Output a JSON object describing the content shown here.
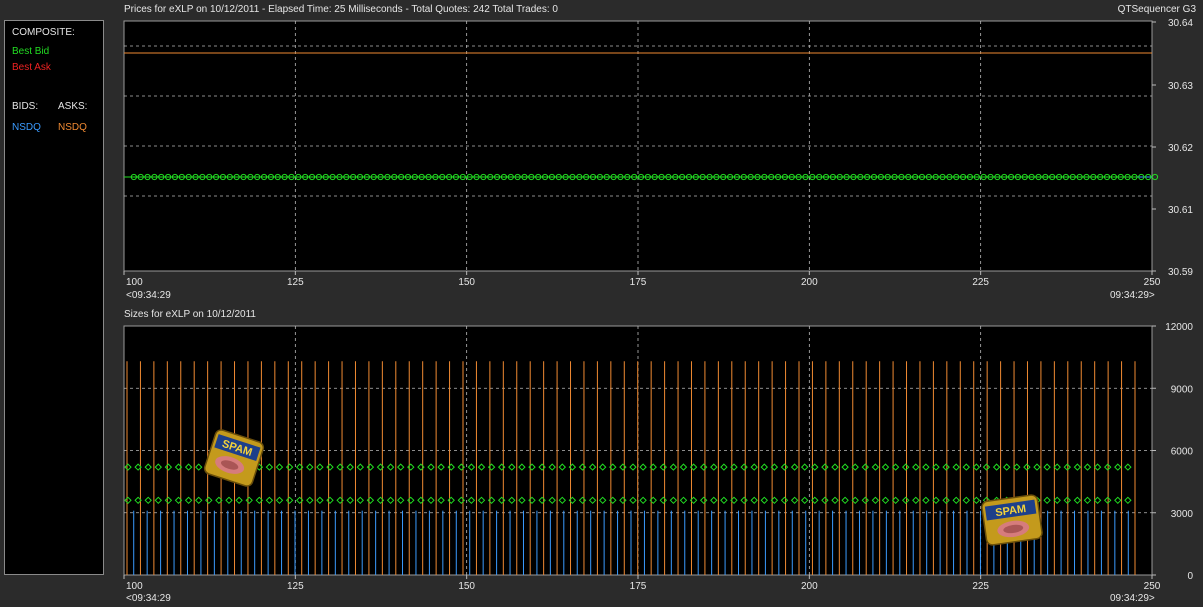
{
  "app": {
    "name": "QTSequencer G3"
  },
  "header": {
    "prices_title": "Prices for  eXLP  on  10/12/2011  -  Elapsed Time: 25 Milliseconds  -  Total Quotes: 242  Total Trades: 0",
    "sizes_title": "Sizes for  eXLP  on  10/12/2011"
  },
  "legend": {
    "composite_label": "COMPOSITE:",
    "best_bid": "Best Bid",
    "best_ask": "Best Ask",
    "bids_label": "BIDS:",
    "asks_label": "ASKS:",
    "bid_venue": "NSDQ",
    "ask_venue": "NSDQ"
  },
  "colors": {
    "best_bid": "#22dd22",
    "best_ask": "#ee2222",
    "bid_series": "#3a9bff",
    "ask_series": "#f08a32",
    "grid": "#bbbbbb",
    "plot_bg": "#000000"
  },
  "chart_data": [
    {
      "type": "line",
      "title": "Prices for  eXLP  on  10/12/2011  -  Elapsed Time: 25 Milliseconds  -  Total Quotes: 242  Total Trades: 0",
      "xlim": [
        100,
        250
      ],
      "ylim": [
        30.59,
        30.64
      ],
      "x_ticks": [
        100,
        125,
        150,
        175,
        200,
        225,
        250
      ],
      "y_tick_labels": [
        "30.64",
        "30.63",
        "30.62",
        "30.61",
        "30.59"
      ],
      "y_tick_values": [
        30.64,
        30.63,
        30.62,
        30.61,
        30.59
      ],
      "x_start_time": "<09:34:29",
      "x_end_time": "09:34:29>",
      "grid": true,
      "series": [
        {
          "name": "NSDQ",
          "role": "ask",
          "value": 30.635
        },
        {
          "name": "NSDQ",
          "role": "bid",
          "value": 30.615
        },
        {
          "name": "Best Bid",
          "role": "best_bid",
          "value": 30.615,
          "markers": true
        }
      ]
    },
    {
      "type": "bar",
      "title": "Sizes for  eXLP  on  10/12/2011",
      "xlim": [
        100,
        250
      ],
      "ylim": [
        0,
        12000
      ],
      "x_ticks": [
        100,
        125,
        150,
        175,
        200,
        225,
        250
      ],
      "y_tick_labels": [
        "12000",
        "9000",
        "6000",
        "3000",
        "0"
      ],
      "y_tick_values": [
        12000,
        9000,
        6000,
        3000,
        0
      ],
      "x_start_time": "<09:34:29",
      "x_end_time": "09:34:29>",
      "grid": true,
      "series": [
        {
          "name": "NSDQ",
          "role": "ask_size",
          "value": 10300
        },
        {
          "name": "NSDQ",
          "role": "bid_size",
          "value": 3100
        },
        {
          "name": "Best Ask",
          "role": "best_ask_size_marker",
          "value": 5200
        },
        {
          "name": "Best Bid",
          "role": "best_bid_size_marker",
          "value": 3600
        }
      ]
    }
  ],
  "decorations": {
    "image_label": "SPAM"
  }
}
